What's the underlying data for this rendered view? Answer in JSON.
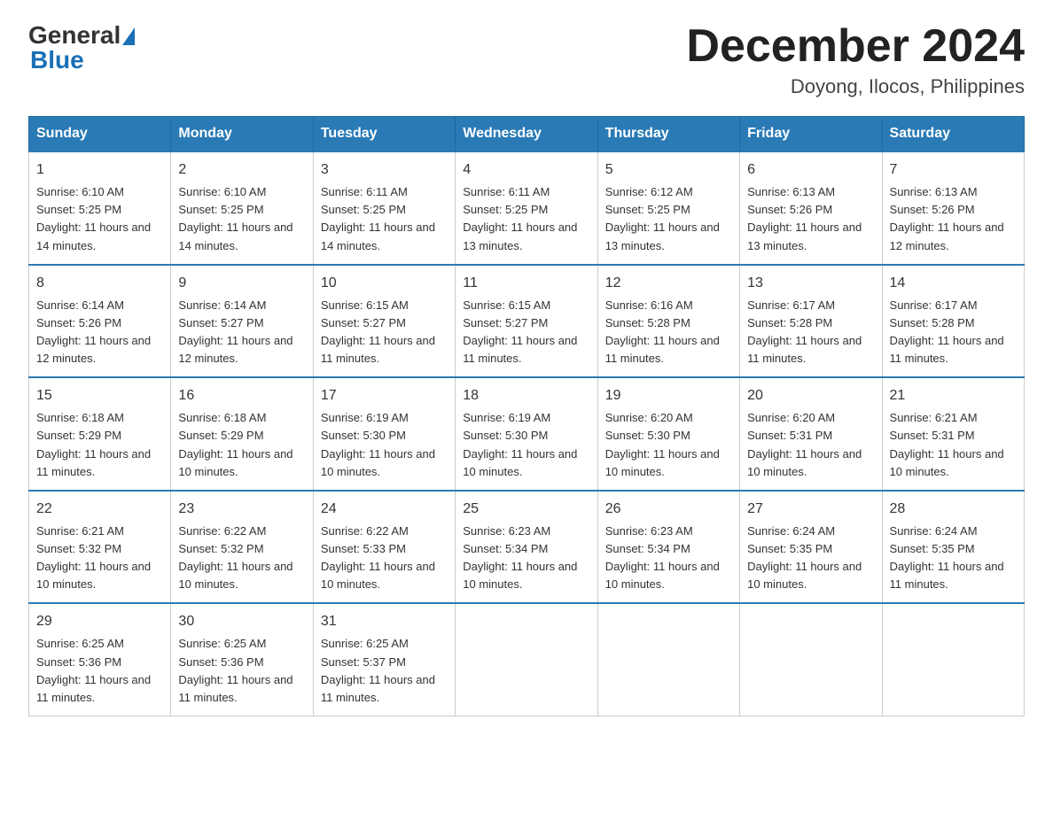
{
  "header": {
    "logo_general": "General",
    "logo_blue": "Blue",
    "month_title": "December 2024",
    "location": "Doyong, Ilocos, Philippines"
  },
  "weekdays": [
    "Sunday",
    "Monday",
    "Tuesday",
    "Wednesday",
    "Thursday",
    "Friday",
    "Saturday"
  ],
  "weeks": [
    [
      {
        "day": "1",
        "sunrise": "6:10 AM",
        "sunset": "5:25 PM",
        "daylight": "11 hours and 14 minutes."
      },
      {
        "day": "2",
        "sunrise": "6:10 AM",
        "sunset": "5:25 PM",
        "daylight": "11 hours and 14 minutes."
      },
      {
        "day": "3",
        "sunrise": "6:11 AM",
        "sunset": "5:25 PM",
        "daylight": "11 hours and 14 minutes."
      },
      {
        "day": "4",
        "sunrise": "6:11 AM",
        "sunset": "5:25 PM",
        "daylight": "11 hours and 13 minutes."
      },
      {
        "day": "5",
        "sunrise": "6:12 AM",
        "sunset": "5:25 PM",
        "daylight": "11 hours and 13 minutes."
      },
      {
        "day": "6",
        "sunrise": "6:13 AM",
        "sunset": "5:26 PM",
        "daylight": "11 hours and 13 minutes."
      },
      {
        "day": "7",
        "sunrise": "6:13 AM",
        "sunset": "5:26 PM",
        "daylight": "11 hours and 12 minutes."
      }
    ],
    [
      {
        "day": "8",
        "sunrise": "6:14 AM",
        "sunset": "5:26 PM",
        "daylight": "11 hours and 12 minutes."
      },
      {
        "day": "9",
        "sunrise": "6:14 AM",
        "sunset": "5:27 PM",
        "daylight": "11 hours and 12 minutes."
      },
      {
        "day": "10",
        "sunrise": "6:15 AM",
        "sunset": "5:27 PM",
        "daylight": "11 hours and 11 minutes."
      },
      {
        "day": "11",
        "sunrise": "6:15 AM",
        "sunset": "5:27 PM",
        "daylight": "11 hours and 11 minutes."
      },
      {
        "day": "12",
        "sunrise": "6:16 AM",
        "sunset": "5:28 PM",
        "daylight": "11 hours and 11 minutes."
      },
      {
        "day": "13",
        "sunrise": "6:17 AM",
        "sunset": "5:28 PM",
        "daylight": "11 hours and 11 minutes."
      },
      {
        "day": "14",
        "sunrise": "6:17 AM",
        "sunset": "5:28 PM",
        "daylight": "11 hours and 11 minutes."
      }
    ],
    [
      {
        "day": "15",
        "sunrise": "6:18 AM",
        "sunset": "5:29 PM",
        "daylight": "11 hours and 11 minutes."
      },
      {
        "day": "16",
        "sunrise": "6:18 AM",
        "sunset": "5:29 PM",
        "daylight": "11 hours and 10 minutes."
      },
      {
        "day": "17",
        "sunrise": "6:19 AM",
        "sunset": "5:30 PM",
        "daylight": "11 hours and 10 minutes."
      },
      {
        "day": "18",
        "sunrise": "6:19 AM",
        "sunset": "5:30 PM",
        "daylight": "11 hours and 10 minutes."
      },
      {
        "day": "19",
        "sunrise": "6:20 AM",
        "sunset": "5:30 PM",
        "daylight": "11 hours and 10 minutes."
      },
      {
        "day": "20",
        "sunrise": "6:20 AM",
        "sunset": "5:31 PM",
        "daylight": "11 hours and 10 minutes."
      },
      {
        "day": "21",
        "sunrise": "6:21 AM",
        "sunset": "5:31 PM",
        "daylight": "11 hours and 10 minutes."
      }
    ],
    [
      {
        "day": "22",
        "sunrise": "6:21 AM",
        "sunset": "5:32 PM",
        "daylight": "11 hours and 10 minutes."
      },
      {
        "day": "23",
        "sunrise": "6:22 AM",
        "sunset": "5:32 PM",
        "daylight": "11 hours and 10 minutes."
      },
      {
        "day": "24",
        "sunrise": "6:22 AM",
        "sunset": "5:33 PM",
        "daylight": "11 hours and 10 minutes."
      },
      {
        "day": "25",
        "sunrise": "6:23 AM",
        "sunset": "5:34 PM",
        "daylight": "11 hours and 10 minutes."
      },
      {
        "day": "26",
        "sunrise": "6:23 AM",
        "sunset": "5:34 PM",
        "daylight": "11 hours and 10 minutes."
      },
      {
        "day": "27",
        "sunrise": "6:24 AM",
        "sunset": "5:35 PM",
        "daylight": "11 hours and 10 minutes."
      },
      {
        "day": "28",
        "sunrise": "6:24 AM",
        "sunset": "5:35 PM",
        "daylight": "11 hours and 11 minutes."
      }
    ],
    [
      {
        "day": "29",
        "sunrise": "6:25 AM",
        "sunset": "5:36 PM",
        "daylight": "11 hours and 11 minutes."
      },
      {
        "day": "30",
        "sunrise": "6:25 AM",
        "sunset": "5:36 PM",
        "daylight": "11 hours and 11 minutes."
      },
      {
        "day": "31",
        "sunrise": "6:25 AM",
        "sunset": "5:37 PM",
        "daylight": "11 hours and 11 minutes."
      },
      null,
      null,
      null,
      null
    ]
  ]
}
